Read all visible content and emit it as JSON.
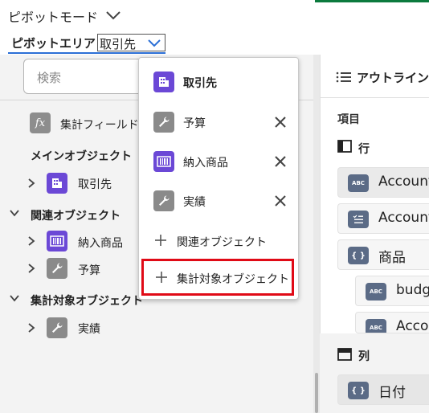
{
  "header": {
    "title": "ピボットモード"
  },
  "pivot_area": {
    "label": "ピボットエリア",
    "selected": "取引先"
  },
  "search": {
    "placeholder": "検索"
  },
  "tree": {
    "summary_field": "集計フィールド",
    "main_object_heading": "メインオブジェクト",
    "main_object": "取引先",
    "related_heading": "関連オブジェクト",
    "related_items": [
      "納入商品",
      "予算"
    ],
    "aggregate_heading": "集計対象オブジェクト",
    "aggregate_items": [
      "実績"
    ]
  },
  "dropdown": {
    "selected": "取引先",
    "items": [
      "予算",
      "納入商品",
      "実績"
    ],
    "add_related": "関連オブジェクト",
    "add_aggregate": "集計対象オブジェクト"
  },
  "outline": {
    "tab_label": "アウトライン",
    "items_heading": "項目",
    "rows_heading": "行",
    "row_fields": [
      "Account",
      "Account",
      "商品",
      "budg",
      "Acco"
    ],
    "row_field_icons": [
      "ABC",
      "list-check",
      "{ }",
      "ABC",
      "ABC"
    ],
    "columns_heading": "列",
    "column_fields": [
      "日付"
    ]
  },
  "colors": {
    "accent_blue": "#2b6fd6",
    "highlight_red": "#e00a16",
    "purple_icon": "#6b48d6",
    "gray_icon": "#8a8a8a",
    "field_icon": "#5b6b86"
  }
}
